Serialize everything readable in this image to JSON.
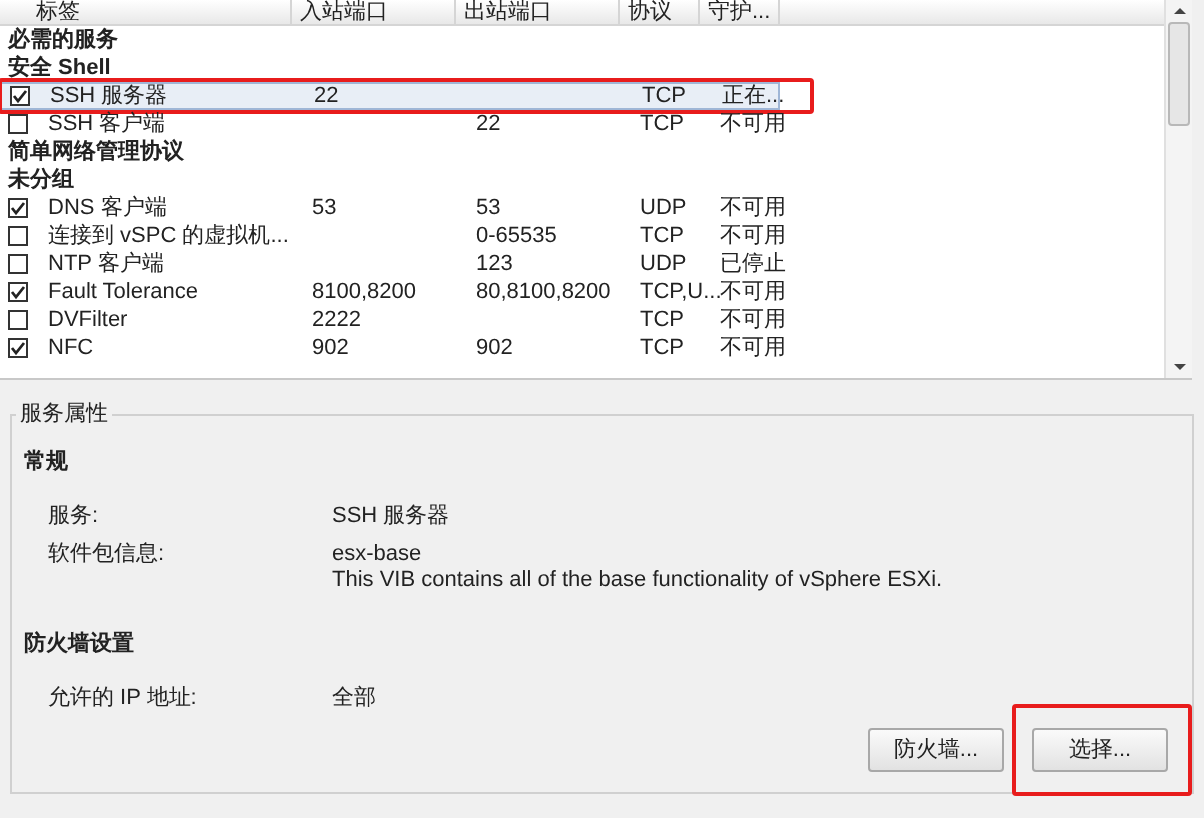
{
  "columns": [
    "标签",
    "入站端口",
    "出站端口",
    "协议",
    "守护..."
  ],
  "rows": [
    {
      "kind": "group",
      "label": "必需的服务"
    },
    {
      "kind": "group",
      "label": "安全 Shell"
    },
    {
      "kind": "service",
      "checked": true,
      "selected": true,
      "highlighted": true,
      "label": "SSH 服务器",
      "inbound": "22",
      "outbound": "",
      "protocol": "TCP",
      "daemon": "正在..."
    },
    {
      "kind": "service",
      "checked": false,
      "selected": false,
      "highlighted": false,
      "label": "SSH 客户端",
      "inbound": "",
      "outbound": "22",
      "protocol": "TCP",
      "daemon": "不可用"
    },
    {
      "kind": "group",
      "label": "简单网络管理协议"
    },
    {
      "kind": "group",
      "label": "未分组"
    },
    {
      "kind": "service",
      "checked": true,
      "selected": false,
      "highlighted": false,
      "label": "DNS 客户端",
      "inbound": "53",
      "outbound": "53",
      "protocol": "UDP",
      "daemon": "不可用"
    },
    {
      "kind": "service",
      "checked": false,
      "selected": false,
      "highlighted": false,
      "label": "连接到 vSPC 的虚拟机...",
      "inbound": "",
      "outbound": "0-65535",
      "protocol": "TCP",
      "daemon": "不可用"
    },
    {
      "kind": "service",
      "checked": false,
      "selected": false,
      "highlighted": false,
      "label": "NTP 客户端",
      "inbound": "",
      "outbound": "123",
      "protocol": "UDP",
      "daemon": "已停止"
    },
    {
      "kind": "service",
      "checked": true,
      "selected": false,
      "highlighted": false,
      "label": "Fault Tolerance",
      "inbound": "8100,8200",
      "outbound": "80,8100,8200",
      "protocol": "TCP,U...",
      "daemon": "不可用"
    },
    {
      "kind": "service",
      "checked": false,
      "selected": false,
      "highlighted": false,
      "label": "DVFilter",
      "inbound": "2222",
      "outbound": "",
      "protocol": "TCP",
      "daemon": "不可用"
    },
    {
      "kind": "service",
      "checked": true,
      "selected": false,
      "highlighted": false,
      "label": "NFC",
      "inbound": "902",
      "outbound": "902",
      "protocol": "TCP",
      "daemon": "不可用"
    }
  ],
  "properties": {
    "title": "服务属性",
    "sections": [
      {
        "heading": "常规",
        "fields": [
          {
            "label": "服务:",
            "values": [
              "SSH 服务器"
            ]
          },
          {
            "label": "软件包信息:",
            "values": [
              "esx-base",
              "This VIB contains all of the base functionality of vSphere ESXi."
            ]
          }
        ]
      },
      {
        "heading": "防火墙设置",
        "fields": [
          {
            "label": "允许的 IP 地址:",
            "values": [
              "全部"
            ]
          }
        ]
      }
    ],
    "buttons": [
      {
        "label": "防火墙...",
        "highlighted": false
      },
      {
        "label": "选择...",
        "highlighted": true
      }
    ]
  }
}
